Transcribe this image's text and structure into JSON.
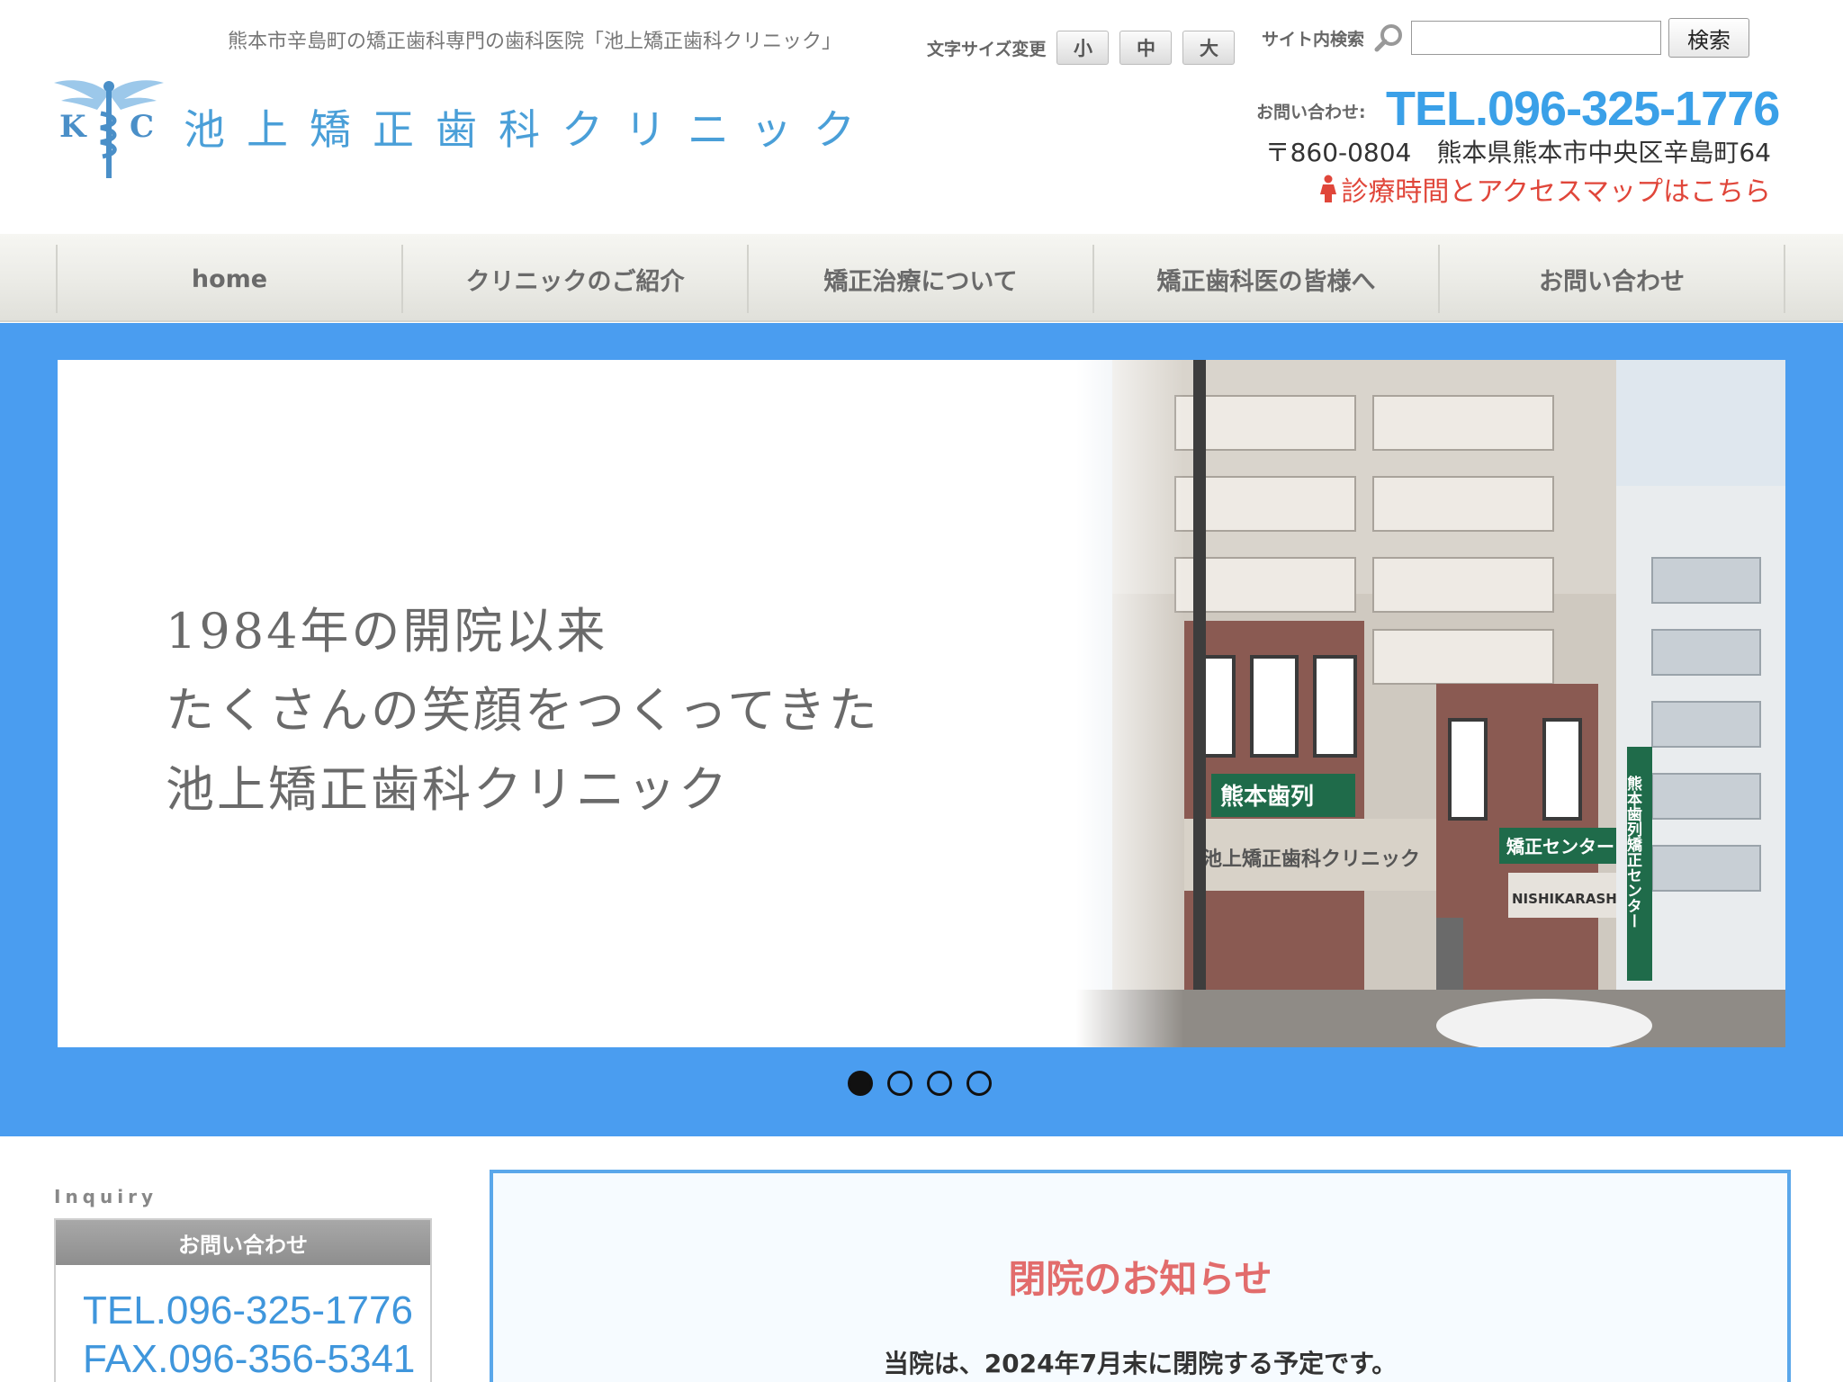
{
  "header": {
    "tagline": "熊本市辛島町の矯正歯科専門の歯科医院「池上矯正歯科クリニック」",
    "logo_text": "池上矯正歯科クリニック",
    "logo_letters": {
      "k": "K",
      "c": "C"
    },
    "fontsize": {
      "label": "文字サイズ変更",
      "small": "小",
      "medium": "中",
      "large": "大"
    },
    "search": {
      "label": "サイト内検索",
      "value": "",
      "button": "検索"
    },
    "contact_label": "お問い合わせ:",
    "tel": "TEL.096-325-1776",
    "address": "〒860-0804　熊本県熊本市中央区辛島町64",
    "access_link": "診療時間とアクセスマップはこちら"
  },
  "nav": {
    "items": [
      {
        "label": "home"
      },
      {
        "label": "クリニックのご紹介"
      },
      {
        "label": "矯正治療について"
      },
      {
        "label": "矯正歯科医の皆様へ"
      },
      {
        "label": "お問い合わせ"
      }
    ]
  },
  "hero": {
    "lines": [
      "1984年の開院以来",
      "たくさんの笑顔をつくってきた",
      "池上矯正歯科クリニック"
    ],
    "photo_signs": {
      "sign_main": "池上矯正歯科クリニック",
      "sign_top": "熊本歯列",
      "sign_center": "矯正センター",
      "sign_right": "熊本歯列矯正センター",
      "sign_salon": "NISHIKARASHIMA"
    },
    "slide_count": 4,
    "active_slide": 1
  },
  "sidebar": {
    "inquiry_en": "Inquiry",
    "inquiry_title": "お問い合わせ",
    "tel": "TEL.096-325-1776",
    "fax": "FAX.096-356-5341"
  },
  "notice": {
    "title": "閉院のお知らせ",
    "body": "当院は、2024年7月末に閉院する予定です。"
  },
  "colors": {
    "brand_blue": "#4a9df0",
    "tel_blue": "#3aa0e8",
    "accent_red": "#e0463a",
    "notice_title": "#e26c6c"
  }
}
